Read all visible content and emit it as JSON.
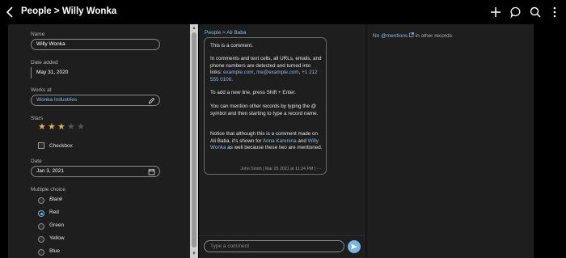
{
  "header": {
    "breadcrumb_parent": "People",
    "breadcrumb_sep": " > ",
    "title": "Willy Wonka",
    "icons": [
      "back-icon",
      "plus-icon",
      "comment-icon",
      "search-icon",
      "more-icon"
    ]
  },
  "fields": {
    "name": {
      "label": "Name",
      "value": "Willy Wonka"
    },
    "date_added": {
      "label": "Date added",
      "value": "May 31, 2020"
    },
    "works_at": {
      "label": "Works at",
      "value": "Wonka Industries"
    },
    "stars": {
      "label": "Stars",
      "rating": 3,
      "max": 5,
      "glyph": "★"
    },
    "checkbox": {
      "label": "Checkbox",
      "checked": false
    },
    "date": {
      "label": "Date",
      "value": "Jan 3, 2021"
    },
    "multiple_choice": {
      "label": "Multiple choice",
      "options": [
        "Blank",
        "Red",
        "Green",
        "Yellow",
        "Blue"
      ],
      "selected": "Red"
    }
  },
  "comments": {
    "crumb": "People > Ali Baba",
    "bubble": {
      "p1": "This is a comment.",
      "p2a": "In comments and text cells, all URLs, emails, and phone numbers are detected and turned into links: ",
      "p2_link1": "example.com",
      "p2_sep": ", ",
      "p2_link2": "me@example.com",
      "p2_sep2": ", ",
      "p2_link3": "+1 212 555 0100",
      "p2_end": ".",
      "p3": "To add a new line, press Shift + Enter.",
      "p4": "You can mention other records by typing the @ symbol and then starting to type a record name.",
      "p5a": "Notice that although this is a comment made on Ali Baba, it's shown for ",
      "p5_link1": "Anna Karenina",
      "p5b": " and ",
      "p5_link2": "Willy Wonka",
      "p5c": " as well because these two are mentioned.",
      "meta": "John Smith | Mar 25 2021 at 11:24 PM | ···"
    },
    "input_placeholder": "Type a comment"
  },
  "mentions_panel": {
    "prefix": "No ",
    "link": "@mentions",
    "suffix": " in other records."
  },
  "colors": {
    "accent": "#74b6e6",
    "link": "#8bbde6",
    "star_on": "#e3b341",
    "star_off": "#555555",
    "panel_bg": "#1e1e1e",
    "page_bg": "#000000"
  }
}
